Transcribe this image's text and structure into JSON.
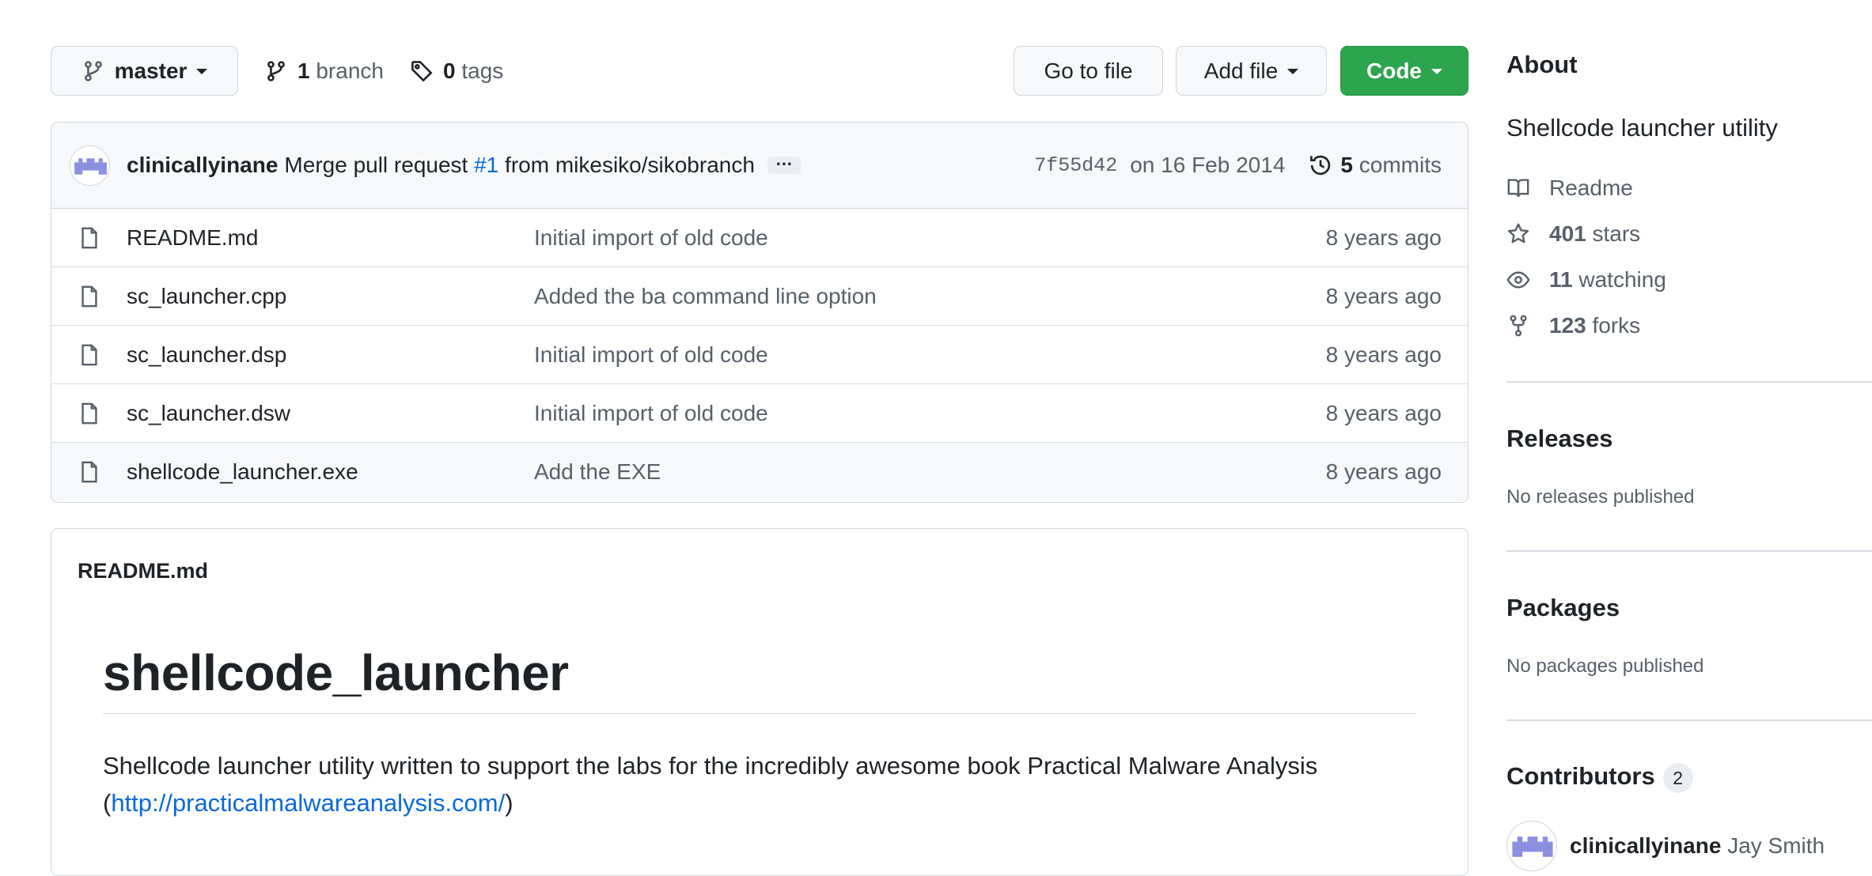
{
  "branch_select": {
    "label": "master",
    "icon": "git-branch-icon"
  },
  "branches": {
    "count": "1",
    "label": "branch"
  },
  "tags": {
    "count": "0",
    "label": "tags"
  },
  "buttons": {
    "go_to_file": "Go to file",
    "add_file": "Add file",
    "code": "Code"
  },
  "commit": {
    "author": "clinicallyinane",
    "message_pre": "Merge pull request ",
    "pr": "#1",
    "message_post": " from mikesiko/sikobranch",
    "ellipsis": "…",
    "sha": "7f55d42",
    "date": "on 16 Feb 2014",
    "commits_count": "5",
    "commits_label": "commits"
  },
  "files": [
    {
      "name": "README.md",
      "message": "Initial import of old code",
      "age": "8 years ago"
    },
    {
      "name": "sc_launcher.cpp",
      "message": "Added the ba command line option",
      "age": "8 years ago"
    },
    {
      "name": "sc_launcher.dsp",
      "message": "Initial import of old code",
      "age": "8 years ago"
    },
    {
      "name": "sc_launcher.dsw",
      "message": "Initial import of old code",
      "age": "8 years ago"
    },
    {
      "name": "shellcode_launcher.exe",
      "message": "Add the EXE",
      "age": "8 years ago"
    }
  ],
  "readme": {
    "file_label": "README.md",
    "title": "shellcode_launcher",
    "body": "Shellcode launcher utility written to support the labs for the incredibly awesome book Practical Malware Analysis",
    "open_paren": "(",
    "link": "http://practicalmalwareanalysis.com/",
    "close_paren": ")"
  },
  "sidebar": {
    "about": {
      "heading": "About",
      "description": "Shellcode launcher utility",
      "readme": "Readme",
      "stars_count": "401",
      "stars_label": "stars",
      "watching_count": "11",
      "watching_label": "watching",
      "forks_count": "123",
      "forks_label": "forks"
    },
    "releases": {
      "heading": "Releases",
      "empty": "No releases published"
    },
    "packages": {
      "heading": "Packages",
      "empty": "No packages published"
    },
    "contributors": {
      "heading": "Contributors",
      "count": "2",
      "first_login": "clinicallyinane",
      "first_name": "Jay Smith"
    }
  },
  "colors": {
    "primary_button": "#2da44e",
    "link": "#0969da",
    "avatar": "#8a8fe0"
  }
}
